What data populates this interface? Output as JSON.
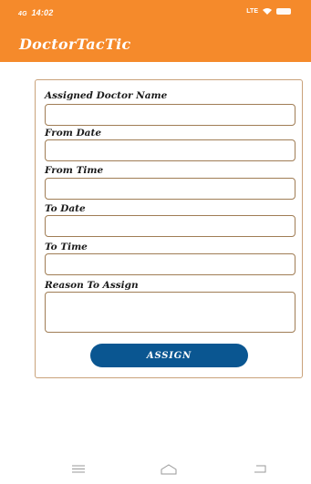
{
  "status_bar": {
    "left_text": "14:02",
    "signal_label": "4G",
    "right_lte": "LTE"
  },
  "app_bar": {
    "title": "DoctorTacTic"
  },
  "form": {
    "fields": [
      {
        "label": "Assigned Doctor Name",
        "value": ""
      },
      {
        "label": "From Date",
        "value": ""
      },
      {
        "label": "From Time",
        "value": ""
      },
      {
        "label": "To Date",
        "value": ""
      },
      {
        "label": "To Time",
        "value": ""
      },
      {
        "label": "Reason To Assign",
        "value": ""
      }
    ],
    "submit_label": "ASSIGN"
  },
  "nav": {
    "icons": [
      "menu-icon",
      "home-icon",
      "back-icon"
    ]
  },
  "colors": {
    "app_bar": "#f58a2b",
    "button": "#0a5691",
    "field_border": "#a07d55"
  }
}
